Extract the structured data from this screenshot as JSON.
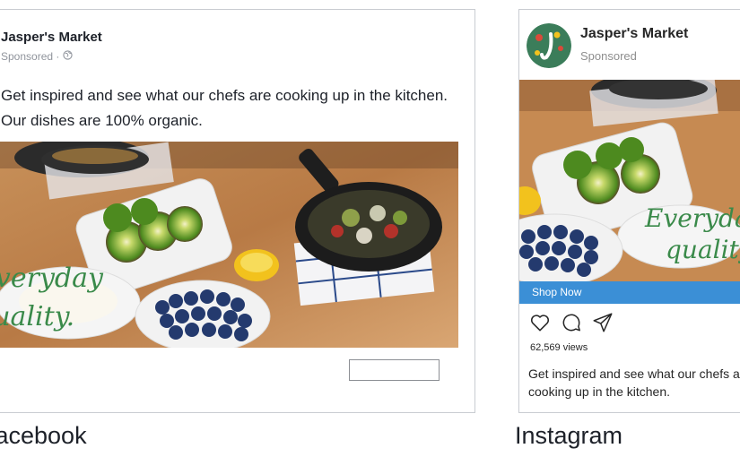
{
  "facebook": {
    "page_name": "Jasper's Market",
    "sponsored": "Sponsored ·",
    "post_text": "Get inspired and see what our chefs are cooking up in the kitchen. Our dishes are 100% organic.",
    "image_overlay": [
      "Everyday",
      "quality."
    ],
    "platform_label": "Facebook"
  },
  "instagram": {
    "account_name": "Jasper's Market",
    "sponsored": "Sponsored",
    "image_overlay": [
      "Everyday",
      "quality."
    ],
    "cta": "Shop Now",
    "views": "62,569 views",
    "caption": "Get inspired and see what our chefs are cooking up in the kitchen.",
    "platform_label": "Instagram"
  },
  "colors": {
    "cta_blue": "#3b8fd6",
    "overlay_green": "#3a8a4a",
    "border": "#c9ccd1"
  },
  "icons": [
    "globe-icon",
    "heart-icon",
    "comment-icon",
    "share-icon"
  ]
}
